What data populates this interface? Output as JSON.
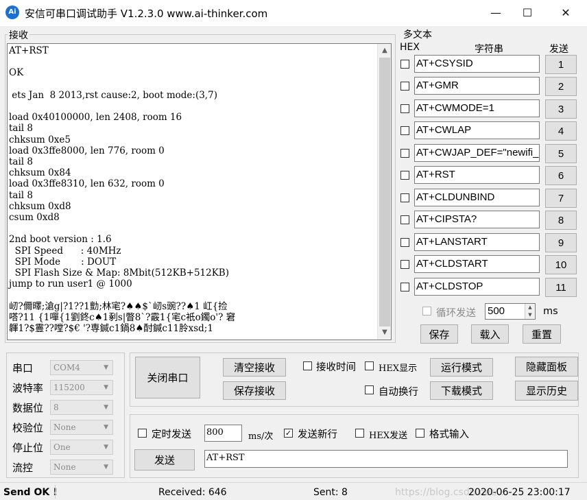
{
  "window": {
    "title": "安信可串口调试助手 V1.2.3.0    www.ai-thinker.com",
    "icon_text": "Ai",
    "minimize": "—",
    "maximize": "☐",
    "close": "✕"
  },
  "receive": {
    "label": "接收",
    "text": "AT+RST\n\nOK\n\n ets Jan  8 2013,rst cause:2, boot mode:(3,7)\n\nload 0x40100000, len 2408, room 16\ntail 8\nchksum 0xe5\nload 0x3ffe8000, len 776, room 0\ntail 8\nchksum 0x84\nload 0x3ffe8310, len 632, room 0\ntail 8\nchksum 0xd8\ncsum 0xd8\n\n2nd boot version : 1.6\n  SPI Speed      : 40MHz\n  SPI Mode       : DOUT\n  SPI Flash Size & Map: 8Mbit(512KB+512KB)\njump to run user1 @ 1000\n\n屻?儞曎;滄g|?1??1勯;林宒?♠♠$`屻s豌??♠1 屸{捡\n嗒?11 {1嘽{1劉鉖c♠1剢s|瞥8`?霰1{宒c衹o鐲o'? 窘\n韗1?$霻??嘡?$€ '?専鍼c1鍋8♠酎鍼c11朎xsd;1"
  },
  "multi": {
    "title": "多文本",
    "hex_header": "HEX",
    "string_header": "字符串",
    "send_header": "发送",
    "rows": [
      {
        "cmd": "AT+CSYSID",
        "num": "1"
      },
      {
        "cmd": "AT+GMR",
        "num": "2"
      },
      {
        "cmd": "AT+CWMODE=1",
        "num": "3"
      },
      {
        "cmd": "AT+CWLAP",
        "num": "4"
      },
      {
        "cmd": "AT+CWJAP_DEF=\"newifi_",
        "num": "5"
      },
      {
        "cmd": "AT+RST",
        "num": "6"
      },
      {
        "cmd": "AT+CLDUNBIND",
        "num": "7"
      },
      {
        "cmd": "AT+CIPSTA?",
        "num": "8"
      },
      {
        "cmd": "AT+LANSTART",
        "num": "9"
      },
      {
        "cmd": "AT+CLDSTART",
        "num": "10"
      },
      {
        "cmd": "AT+CLDSTOP",
        "num": "11"
      }
    ],
    "loop_send": "循环发送",
    "loop_value": "500",
    "ms": "ms",
    "save": "保存",
    "load": "载入",
    "reset": "重置"
  },
  "settings": {
    "port_label": "串口",
    "port_value": "COM4",
    "baud_label": "波特率",
    "baud_value": "115200",
    "databits_label": "数据位",
    "databits_value": "8",
    "parity_label": "校验位",
    "parity_value": "None",
    "stopbits_label": "停止位",
    "stopbits_value": "One",
    "flow_label": "流控",
    "flow_value": "None"
  },
  "controls": {
    "close_port": "关闭串口",
    "clear_recv": "清空接收",
    "save_recv": "保存接收",
    "recv_time": "接收时间",
    "hex_display": "HEX显示",
    "auto_wrap": "自动换行",
    "run_mode": "运行模式",
    "download_mode": "下载模式",
    "hide_panel": "隐藏面板",
    "show_history": "显示历史"
  },
  "send": {
    "timed_send": "定时发送",
    "interval": "800",
    "ms_per": "ms/次",
    "send_newline": "发送新行",
    "hex_send": "HEX发送",
    "format_input": "格式输入",
    "send_button": "发送",
    "input_value": "AT+RST"
  },
  "status": {
    "message": "Send OK !",
    "received": "Received: 646",
    "sent": "Sent: 8",
    "watermark": "https://blog.csdn.net/...",
    "datetime": "2020-06-25 23:00:17"
  }
}
